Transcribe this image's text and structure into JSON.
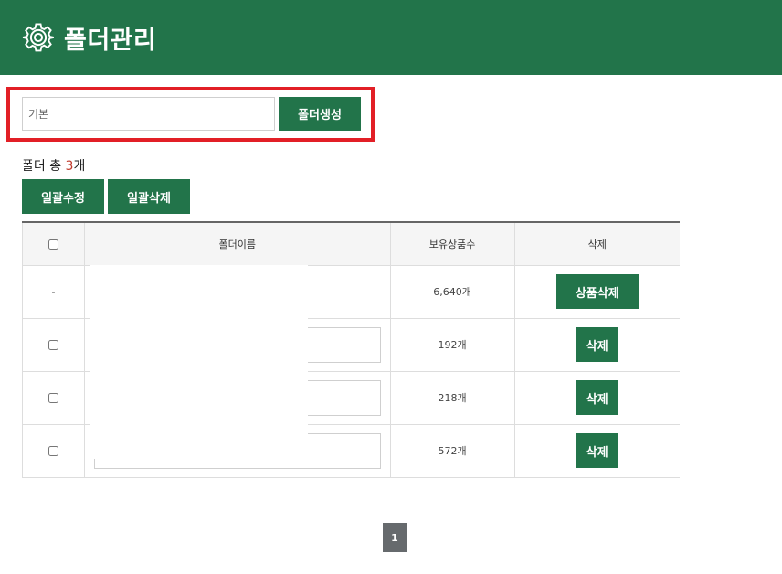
{
  "colors": {
    "brand": "#22744a",
    "highlight_border": "#e21f26",
    "count_accent": "#c0392b"
  },
  "header": {
    "title": "폴더관리",
    "icon": "gear-icon"
  },
  "create": {
    "input_placeholder": "기본",
    "button_label": "폴더생성"
  },
  "summary": {
    "prefix": "폴더 총",
    "count": "3",
    "suffix": "개"
  },
  "bulk": {
    "edit_label": "일괄수정",
    "delete_label": "일괄삭제"
  },
  "table": {
    "columns": [
      "",
      "폴더이름",
      "보유상품수",
      "삭제"
    ],
    "rows": [
      {
        "check": "-",
        "product_count": "6,640개",
        "action": "상품삭제"
      },
      {
        "product_count": "192개",
        "action": "삭제"
      },
      {
        "product_count": "218개",
        "action": "삭제"
      },
      {
        "product_count": "572개",
        "action": "삭제"
      }
    ]
  },
  "pagination": {
    "current_page": "1"
  }
}
